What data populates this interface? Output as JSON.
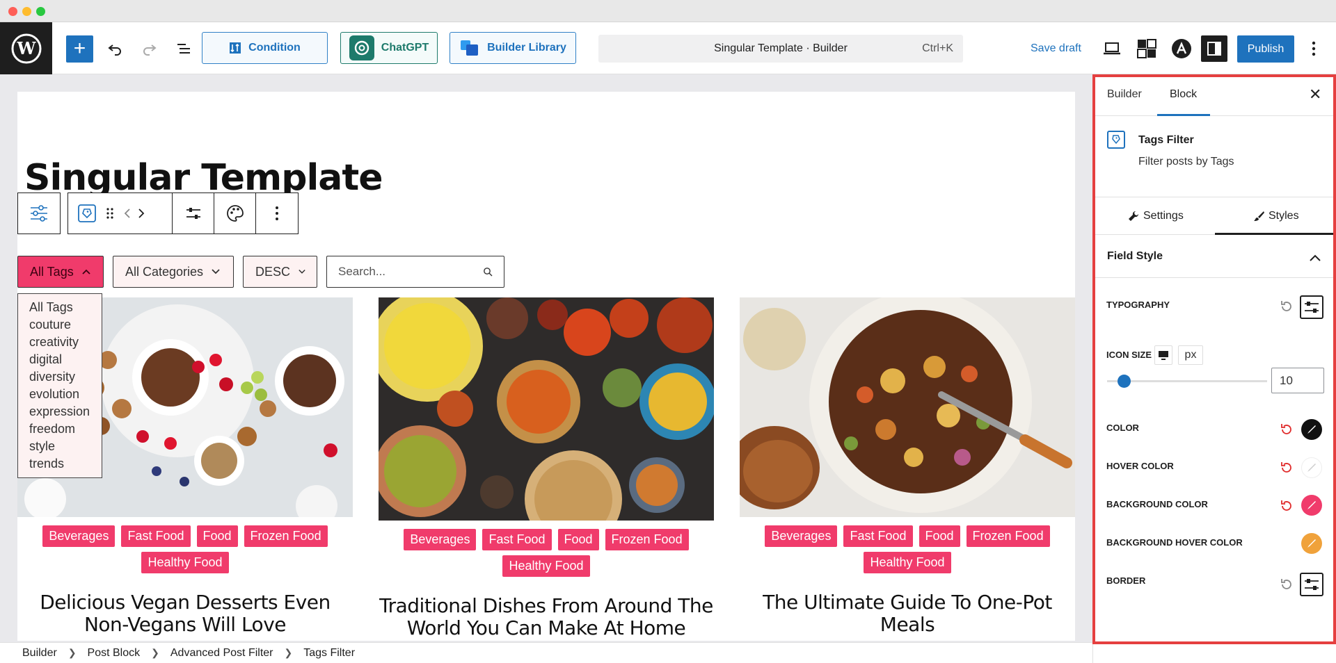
{
  "colors": {
    "accent": "#1e72bd",
    "tag_pink": "#f03b6b",
    "chatgpt_green": "#1d7a6b",
    "highlight_red": "#e54040"
  },
  "toolbar": {
    "condition_label": "Condition",
    "chatgpt_label": "ChatGPT",
    "builder_library_label": "Builder Library",
    "command_title": "Singular Template · Builder",
    "command_shortcut": "Ctrl+K",
    "save_draft_label": "Save draft",
    "publish_label": "Publish"
  },
  "canvas": {
    "page_title": "Singular Template",
    "filters": {
      "tags_label": "All Tags",
      "categories_label": "All Categories",
      "order_label": "DESC",
      "search_placeholder": "Search..."
    },
    "tag_options": [
      "All Tags",
      "couture",
      "creativity",
      "digital",
      "diversity",
      "evolution",
      "expression",
      "freedom",
      "style",
      "trends"
    ],
    "posts": [
      {
        "tags": [
          "Beverages",
          "Fast Food",
          "Food",
          "Frozen Food",
          "Healthy Food"
        ],
        "title": "Delicious Vegan Desserts Even Non-Vegans Will Love"
      },
      {
        "tags": [
          "Beverages",
          "Fast Food",
          "Food",
          "Frozen Food",
          "Healthy Food"
        ],
        "title": "Traditional Dishes From Around The World You Can Make At Home"
      },
      {
        "tags": [
          "Beverages",
          "Fast Food",
          "Food",
          "Frozen Food",
          "Healthy Food"
        ],
        "title": "The Ultimate Guide To One-Pot Meals"
      }
    ]
  },
  "breadcrumb": [
    "Builder",
    "Post Block",
    "Advanced Post Filter",
    "Tags Filter"
  ],
  "panel": {
    "tab_builder": "Builder",
    "tab_block": "Block",
    "block_name": "Tags Filter",
    "block_description": "Filter posts by Tags",
    "settings_tab": "Settings",
    "styles_tab": "Styles",
    "section_title": "Field Style",
    "typography_label": "TYPOGRAPHY",
    "icon_size_label": "ICON SIZE",
    "icon_size_unit": "px",
    "icon_size_value": "10",
    "icon_size_fraction": 0.1,
    "color_label": "COLOR",
    "hover_color_label": "HOVER COLOR",
    "bg_color_label": "BACKGROUND COLOR",
    "bg_hover_color_label": "BACKGROUND HOVER COLOR",
    "border_label": "BORDER",
    "swatches": {
      "color": "#111111",
      "hover_color": "#ffffff",
      "bg_color": "#f03b6b",
      "bg_hover_color": "#f0a23b"
    }
  }
}
